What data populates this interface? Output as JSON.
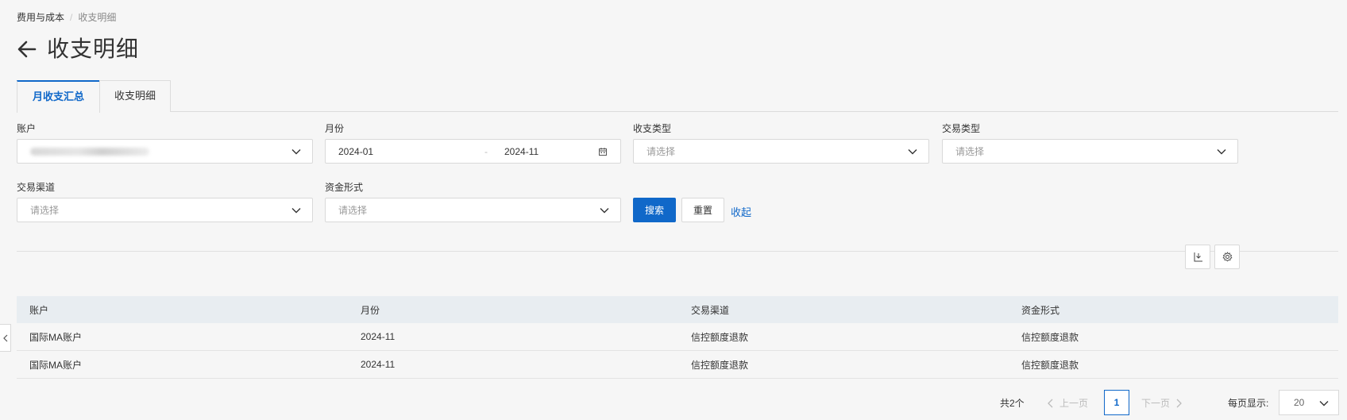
{
  "breadcrumb": {
    "parent": "费用与成本",
    "separator": "/",
    "current": "收支明细"
  },
  "page": {
    "title": "收支明细"
  },
  "tabs": [
    {
      "label": "月收支汇总",
      "active": true
    },
    {
      "label": "收支明细",
      "active": false
    }
  ],
  "filters": {
    "account": {
      "label": "账户"
    },
    "month": {
      "label": "月份",
      "start": "2024-01",
      "separator": "-",
      "end": "2024-11"
    },
    "income_type": {
      "label": "收支类型",
      "placeholder": "请选择"
    },
    "trade_type": {
      "label": "交易类型",
      "placeholder": "请选择"
    },
    "trade_channel": {
      "label": "交易渠道",
      "placeholder": "请选择"
    },
    "fund_form": {
      "label": "资金形式",
      "placeholder": "请选择"
    }
  },
  "actions": {
    "search": "搜索",
    "reset": "重置",
    "collapse": "收起"
  },
  "toolbar": {
    "download_icon": "download-icon",
    "settings_icon": "gear-icon"
  },
  "table": {
    "columns": [
      "账户",
      "月份",
      "交易渠道",
      "资金形式"
    ],
    "rows": [
      [
        "国际MA账户",
        "2024-11",
        "信控额度退款",
        "信控额度退款"
      ],
      [
        "国际MA账户",
        "2024-11",
        "信控额度退款",
        "信控额度退款"
      ]
    ]
  },
  "pagination": {
    "total": "共2个",
    "prev": "上一页",
    "next": "下一页",
    "current_page": "1",
    "page_size_label": "每页显示:",
    "page_size": "20"
  },
  "colors": {
    "accent": "#1068c9",
    "background": "#f6f6f6",
    "table_header": "#e8edf1"
  }
}
